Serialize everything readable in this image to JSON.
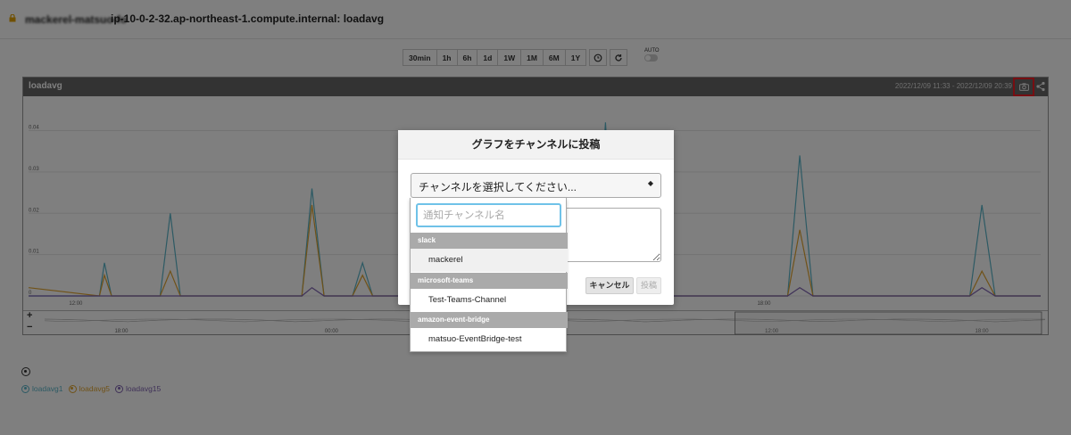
{
  "header": {
    "host_blurred": "mackerel-matsuo-fo",
    "host_title": "ip-10-0-2-32.ap-northeast-1.compute.internal: loadavg"
  },
  "toolbar": {
    "ranges": [
      "30min",
      "1h",
      "6h",
      "1d",
      "1W",
      "1M",
      "6M",
      "1Y"
    ],
    "auto_label": "AUTO"
  },
  "panel": {
    "title": "loadavg",
    "range_text": "2022/12/09 11:33 - 2022/12/09 20:39"
  },
  "chart_data": {
    "type": "line",
    "yticks": [
      "0.04",
      "0.03",
      "0.02",
      "0.01",
      "0"
    ],
    "xticks": [
      "12:00",
      "18:00"
    ],
    "ylim": [
      0,
      0.044
    ],
    "series": [
      {
        "name": "loadavg1",
        "color": "#5ab4c8",
        "points": [
          [
            0.0,
            0
          ],
          [
            0.07,
            0
          ],
          [
            0.075,
            0.008
          ],
          [
            0.082,
            0
          ],
          [
            0.13,
            0
          ],
          [
            0.14,
            0.02
          ],
          [
            0.15,
            0
          ],
          [
            0.27,
            0
          ],
          [
            0.28,
            0.026
          ],
          [
            0.292,
            0
          ],
          [
            0.32,
            0
          ],
          [
            0.33,
            0.008
          ],
          [
            0.34,
            0
          ],
          [
            0.56,
            0
          ],
          [
            0.57,
            0.042
          ],
          [
            0.58,
            0
          ],
          [
            0.75,
            0
          ],
          [
            0.762,
            0.034
          ],
          [
            0.775,
            0
          ],
          [
            0.93,
            0
          ],
          [
            0.942,
            0.022
          ],
          [
            0.955,
            0
          ],
          [
            1.0,
            0
          ]
        ]
      },
      {
        "name": "loadavg5",
        "color": "#e0a430",
        "points": [
          [
            0.0,
            0.002
          ],
          [
            0.07,
            0
          ],
          [
            0.075,
            0.005
          ],
          [
            0.082,
            0
          ],
          [
            0.13,
            0
          ],
          [
            0.14,
            0.006
          ],
          [
            0.15,
            0
          ],
          [
            0.27,
            0
          ],
          [
            0.28,
            0.022
          ],
          [
            0.292,
            0
          ],
          [
            0.32,
            0
          ],
          [
            0.33,
            0.005
          ],
          [
            0.34,
            0
          ],
          [
            0.75,
            0
          ],
          [
            0.762,
            0.016
          ],
          [
            0.775,
            0
          ],
          [
            0.93,
            0
          ],
          [
            0.942,
            0.006
          ],
          [
            0.955,
            0
          ],
          [
            1.0,
            0
          ]
        ]
      },
      {
        "name": "loadavg15",
        "color": "#7f62b0",
        "points": [
          [
            0.0,
            0
          ],
          [
            0.27,
            0
          ],
          [
            0.28,
            0.002
          ],
          [
            0.292,
            0
          ],
          [
            0.75,
            0
          ],
          [
            0.762,
            0.002
          ],
          [
            0.775,
            0
          ],
          [
            0.93,
            0
          ],
          [
            0.942,
            0.002
          ],
          [
            0.955,
            0
          ],
          [
            1.0,
            0
          ]
        ]
      }
    ],
    "navigator_ticks": [
      "18:00",
      "00:00",
      "12:00",
      "18:00"
    ],
    "grid": true
  },
  "legend": {
    "items": [
      {
        "name": "loadavg1",
        "color": "#5ab4c8"
      },
      {
        "name": "loadavg5",
        "color": "#e0a430"
      },
      {
        "name": "loadavg15",
        "color": "#7f62b0"
      }
    ]
  },
  "modal": {
    "title": "グラフをチャンネルに投稿",
    "select_label": "チャンネルを選択してください...",
    "cancel_label": "キャンセル",
    "submit_label": "投稿"
  },
  "dropdown": {
    "search_placeholder": "通知チャンネル名",
    "groups": [
      {
        "name": "slack",
        "options": [
          "mackerel"
        ]
      },
      {
        "name": "microsoft-teams",
        "options": [
          "Test-Teams-Channel"
        ]
      },
      {
        "name": "amazon-event-bridge",
        "options": [
          "matsuo-EventBridge-test"
        ]
      }
    ]
  }
}
